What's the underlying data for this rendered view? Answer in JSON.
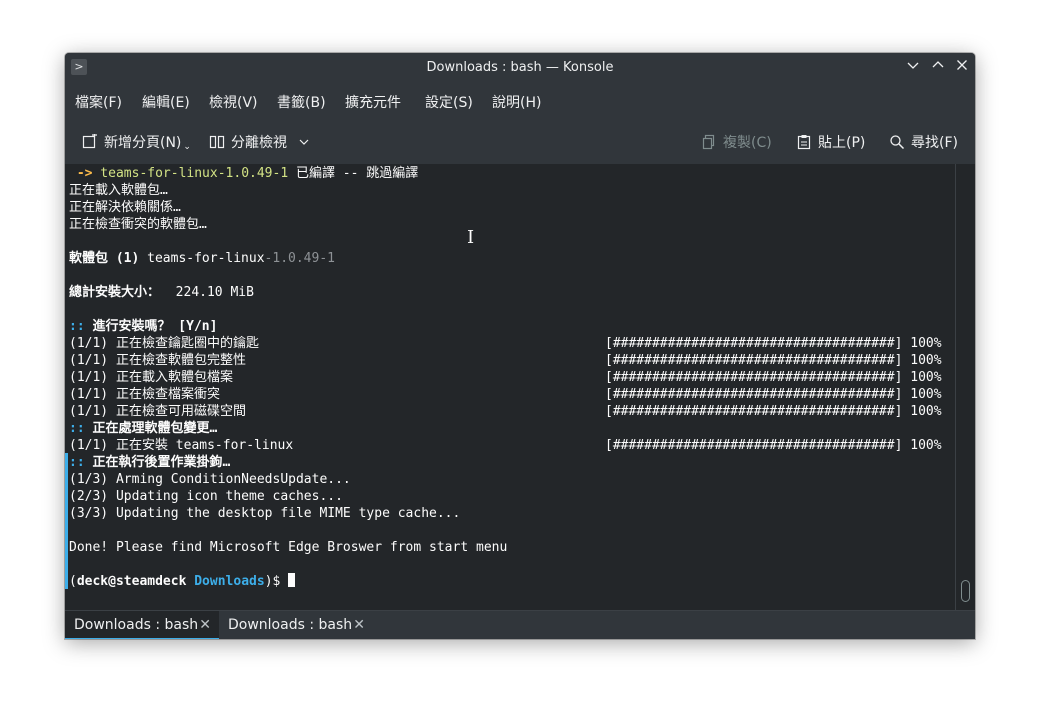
{
  "window": {
    "title": "Downloads : bash — Konsole",
    "app_icon": "konsole-icon",
    "buttons": [
      "minimize-chevron-icon",
      "maximize-chevron-icon",
      "close-icon"
    ]
  },
  "menubar": {
    "items": [
      "檔案(F)",
      "編輯(E)",
      "檢視(V)",
      "書籤(B)",
      "擴充元件",
      "設定(S)",
      "說明(H)"
    ]
  },
  "toolbar": {
    "new_tab": "新增分頁(N)",
    "split_view": "分離檢視",
    "copy": "複製(C)",
    "paste": "貼上(P)",
    "find": "尋找(F)"
  },
  "terminal": {
    "line_01": {
      "arrow": " ->",
      "pkg": " teams-for-linux-1.0.49-1",
      "rest": " 已編譯 -- 跳過編譯"
    },
    "line_02": "正在載入軟體包…",
    "line_03": "正在解決依賴關係…",
    "line_04": "正在檢查衝突的軟體包…",
    "line_06": {
      "label": "軟體包 (1)",
      "name": " teams-for-linux",
      "version": "-1.0.49-1"
    },
    "line_08": {
      "label": "總計安裝大小：",
      "value": "  224.10 MiB"
    },
    "line_10": {
      "prefix": "::",
      "text": " 進行安裝嗎？ [Y/n]"
    },
    "line_11": "(1/1) 正在檢查鑰匙圈中的鑰匙",
    "line_12": "(1/1) 正在檢查軟體包完整性",
    "line_13": "(1/1) 正在載入軟體包檔案",
    "line_14": "(1/1) 正在檢查檔案衝突",
    "line_15": "(1/1) 正在檢查可用磁碟空間",
    "line_16": {
      "prefix": "::",
      "text": " 正在處理軟體包變更…"
    },
    "line_17": "(1/1) 正在安裝 teams-for-linux",
    "line_18": {
      "prefix": "::",
      "text": " 正在執行後置作業掛鉤…"
    },
    "line_19": "(1/3) Arming ConditionNeedsUpdate...",
    "line_20": "(2/3) Updating icon theme caches...",
    "line_21": "(3/3) Updating the desktop file MIME type cache...",
    "line_23": "Done! Please find Microsoft Edge Broswer from start menu",
    "prompt": {
      "open": "(",
      "user": "deck@steamdeck",
      "dir": " Downloads",
      "close": ")$ "
    },
    "progress_bar": "[####################################] 100%",
    "progress_values": [
      1.0,
      1.0,
      1.0,
      1.0,
      1.0,
      1.0
    ]
  },
  "tabs": [
    {
      "label": "Downloads : bash",
      "active": true
    },
    {
      "label": "Downloads : bash",
      "active": false
    }
  ],
  "colors": {
    "accent": "#3daee9",
    "arrow": "#fdbc4b",
    "pkg": "#d3e385",
    "dim": "#8e9296",
    "background": "#232629",
    "chrome": "#31363b"
  }
}
